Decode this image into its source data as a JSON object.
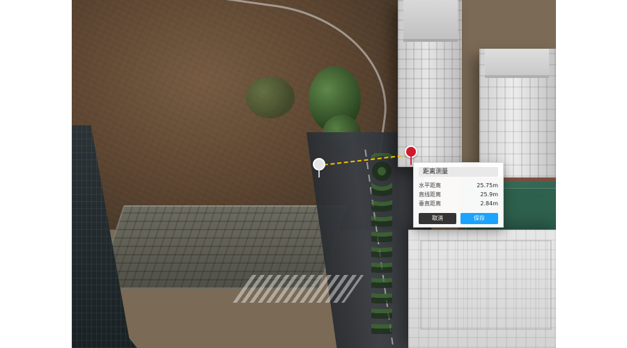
{
  "measurement_panel": {
    "title": "距离测量",
    "rows": [
      {
        "label": "水平距离",
        "value": "25.75m"
      },
      {
        "label": "直线距离",
        "value": "25.9m"
      },
      {
        "label": "垂直距离",
        "value": "2.84m"
      }
    ],
    "actions": {
      "cancel": "取消",
      "save": "保存"
    }
  },
  "style": {
    "accent_blue": "#1aa3ff",
    "marker_red": "#d1192e",
    "line_yellow": "#f2c200",
    "panel_bg": "#ffffff",
    "cancel_bg": "#343434"
  }
}
